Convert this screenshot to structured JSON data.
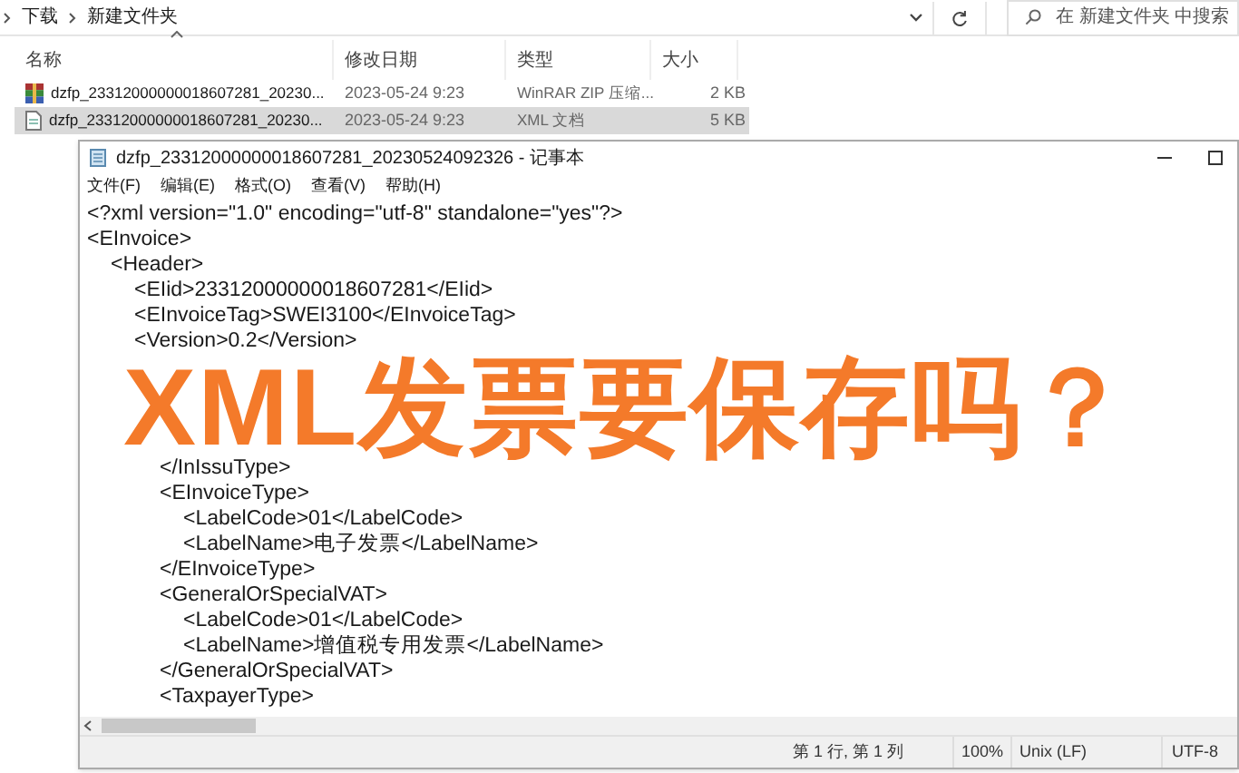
{
  "explorer": {
    "breadcrumb": [
      "下载",
      "新建文件夹"
    ],
    "search": {
      "placeholder": "在 新建文件夹 中搜索"
    },
    "columns": [
      "名称",
      "修改日期",
      "类型",
      "大小"
    ],
    "files": [
      {
        "kind": "archive",
        "name": "dzfp_23312000000018607281_20230...",
        "date": "2023-05-24 9:23",
        "type": "WinRAR ZIP 压缩...",
        "size": "2 KB",
        "selected": false
      },
      {
        "kind": "xml",
        "name": "dzfp_23312000000018607281_20230...",
        "date": "2023-05-24 9:23",
        "type": "XML 文档",
        "size": "5 KB",
        "selected": true
      }
    ]
  },
  "notepad": {
    "title": "dzfp_23312000000018607281_20230524092326 - 记事本",
    "menu": [
      "文件(F)",
      "编辑(E)",
      "格式(O)",
      "查看(V)",
      "帮助(H)"
    ],
    "lines": [
      {
        "text": "<?xml version=\"1.0\" encoding=\"utf-8\" standalone=\"yes\"?>"
      },
      {
        "text": "<EInvoice>",
        "children": [
          {
            "text": "<Header>",
            "children": [
              {
                "text": "<EIid>23312000000018607281</EIid>"
              },
              {
                "text": "<EInvoiceTag>SWEI3100</EInvoiceTag>"
              },
              {
                "text": "<Version>0.2</Version>"
              },
              {
                "covered": true,
                "children": [
                  {
                    "covered": true,
                    "children": [
                      {
                        "covered": true
                      },
                      {
                        "covered": true
                      }
                    ]
                  },
                  {
                    "text": "</InIssuType>"
                  },
                  {
                    "text": "<EInvoiceType>",
                    "children": [
                      {
                        "text": "<LabelCode>01</LabelCode>"
                      },
                      {
                        "text": "<LabelName>电子发票</LabelName>"
                      }
                    ]
                  },
                  {
                    "text": "</EInvoiceType>"
                  },
                  {
                    "text": "<GeneralOrSpecialVAT>",
                    "children": [
                      {
                        "text": "<LabelCode>01</LabelCode>"
                      },
                      {
                        "text": "<LabelName>增值税专用发票</LabelName>"
                      }
                    ]
                  },
                  {
                    "text": "</GeneralOrSpecialVAT>"
                  },
                  {
                    "text": "<TaxpayerType>"
                  }
                ]
              }
            ]
          }
        ]
      }
    ],
    "status": [
      "第 1 行, 第 1 列",
      "100%",
      "Unix (LF)",
      "UTF-8"
    ]
  },
  "overlay_title": "XML发票要保存吗？"
}
